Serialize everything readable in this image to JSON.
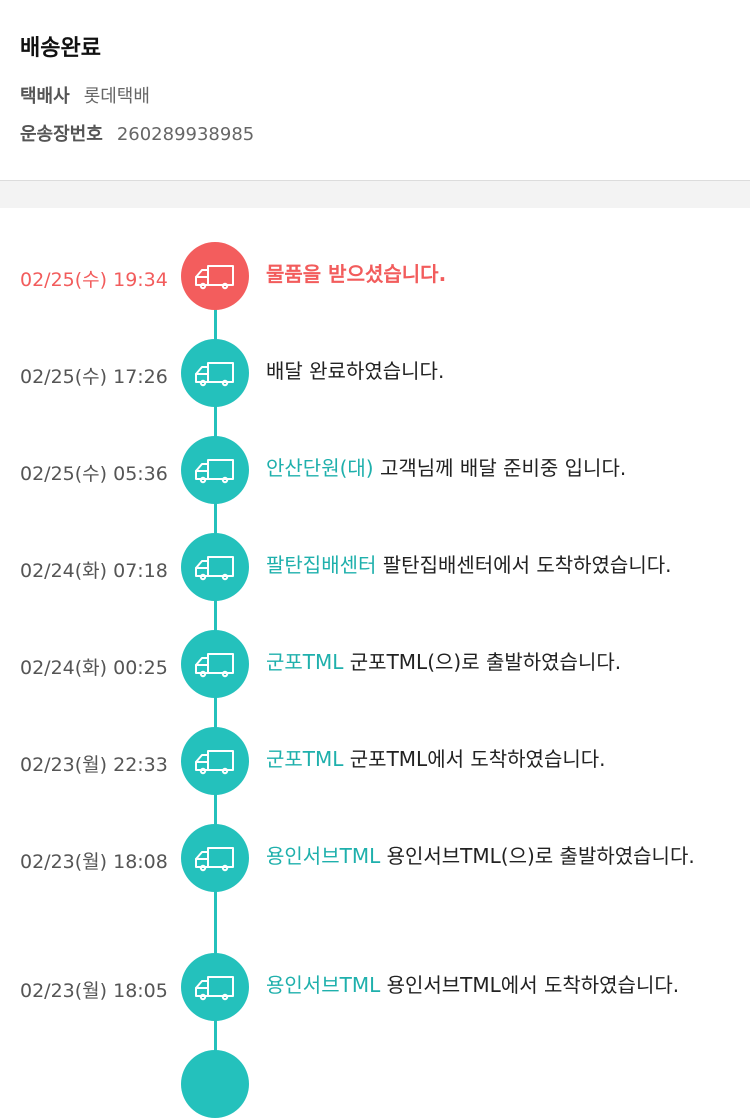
{
  "header": {
    "status": "배송완료",
    "carrier_label": "택배사",
    "carrier_value": "롯데택배",
    "tracking_label": "운송장번호",
    "tracking_value": "260289938985"
  },
  "colors": {
    "accent": "#24c1bc",
    "active": "#f35d5d"
  },
  "icons": {
    "step_icon": "truck-icon"
  },
  "timeline": [
    {
      "time": "02/25(수) 19:34",
      "location": "",
      "message": "물품을 받으셨습니다."
    },
    {
      "time": "02/25(수) 17:26",
      "location": "",
      "message": "배달 완료하였습니다."
    },
    {
      "time": "02/25(수) 05:36",
      "location": "안산단원(대)",
      "message": "고객님께 배달 준비중 입니다."
    },
    {
      "time": "02/24(화) 07:18",
      "location": "팔탄집배센터",
      "message": "팔탄집배센터에서 도착하였습니다."
    },
    {
      "time": "02/24(화) 00:25",
      "location": "군포TML",
      "message": "군포TML(으)로 출발하였습니다."
    },
    {
      "time": "02/23(월) 22:33",
      "location": "군포TML",
      "message": "군포TML에서 도착하였습니다."
    },
    {
      "time": "02/23(월) 18:08",
      "location": "용인서브TML",
      "message": "용인서브TML(으)로 출발하였습니다."
    },
    {
      "time": "02/23(월) 18:05",
      "location": "용인서브TML",
      "message": "용인서브TML에서 도착하였습니다."
    }
  ]
}
